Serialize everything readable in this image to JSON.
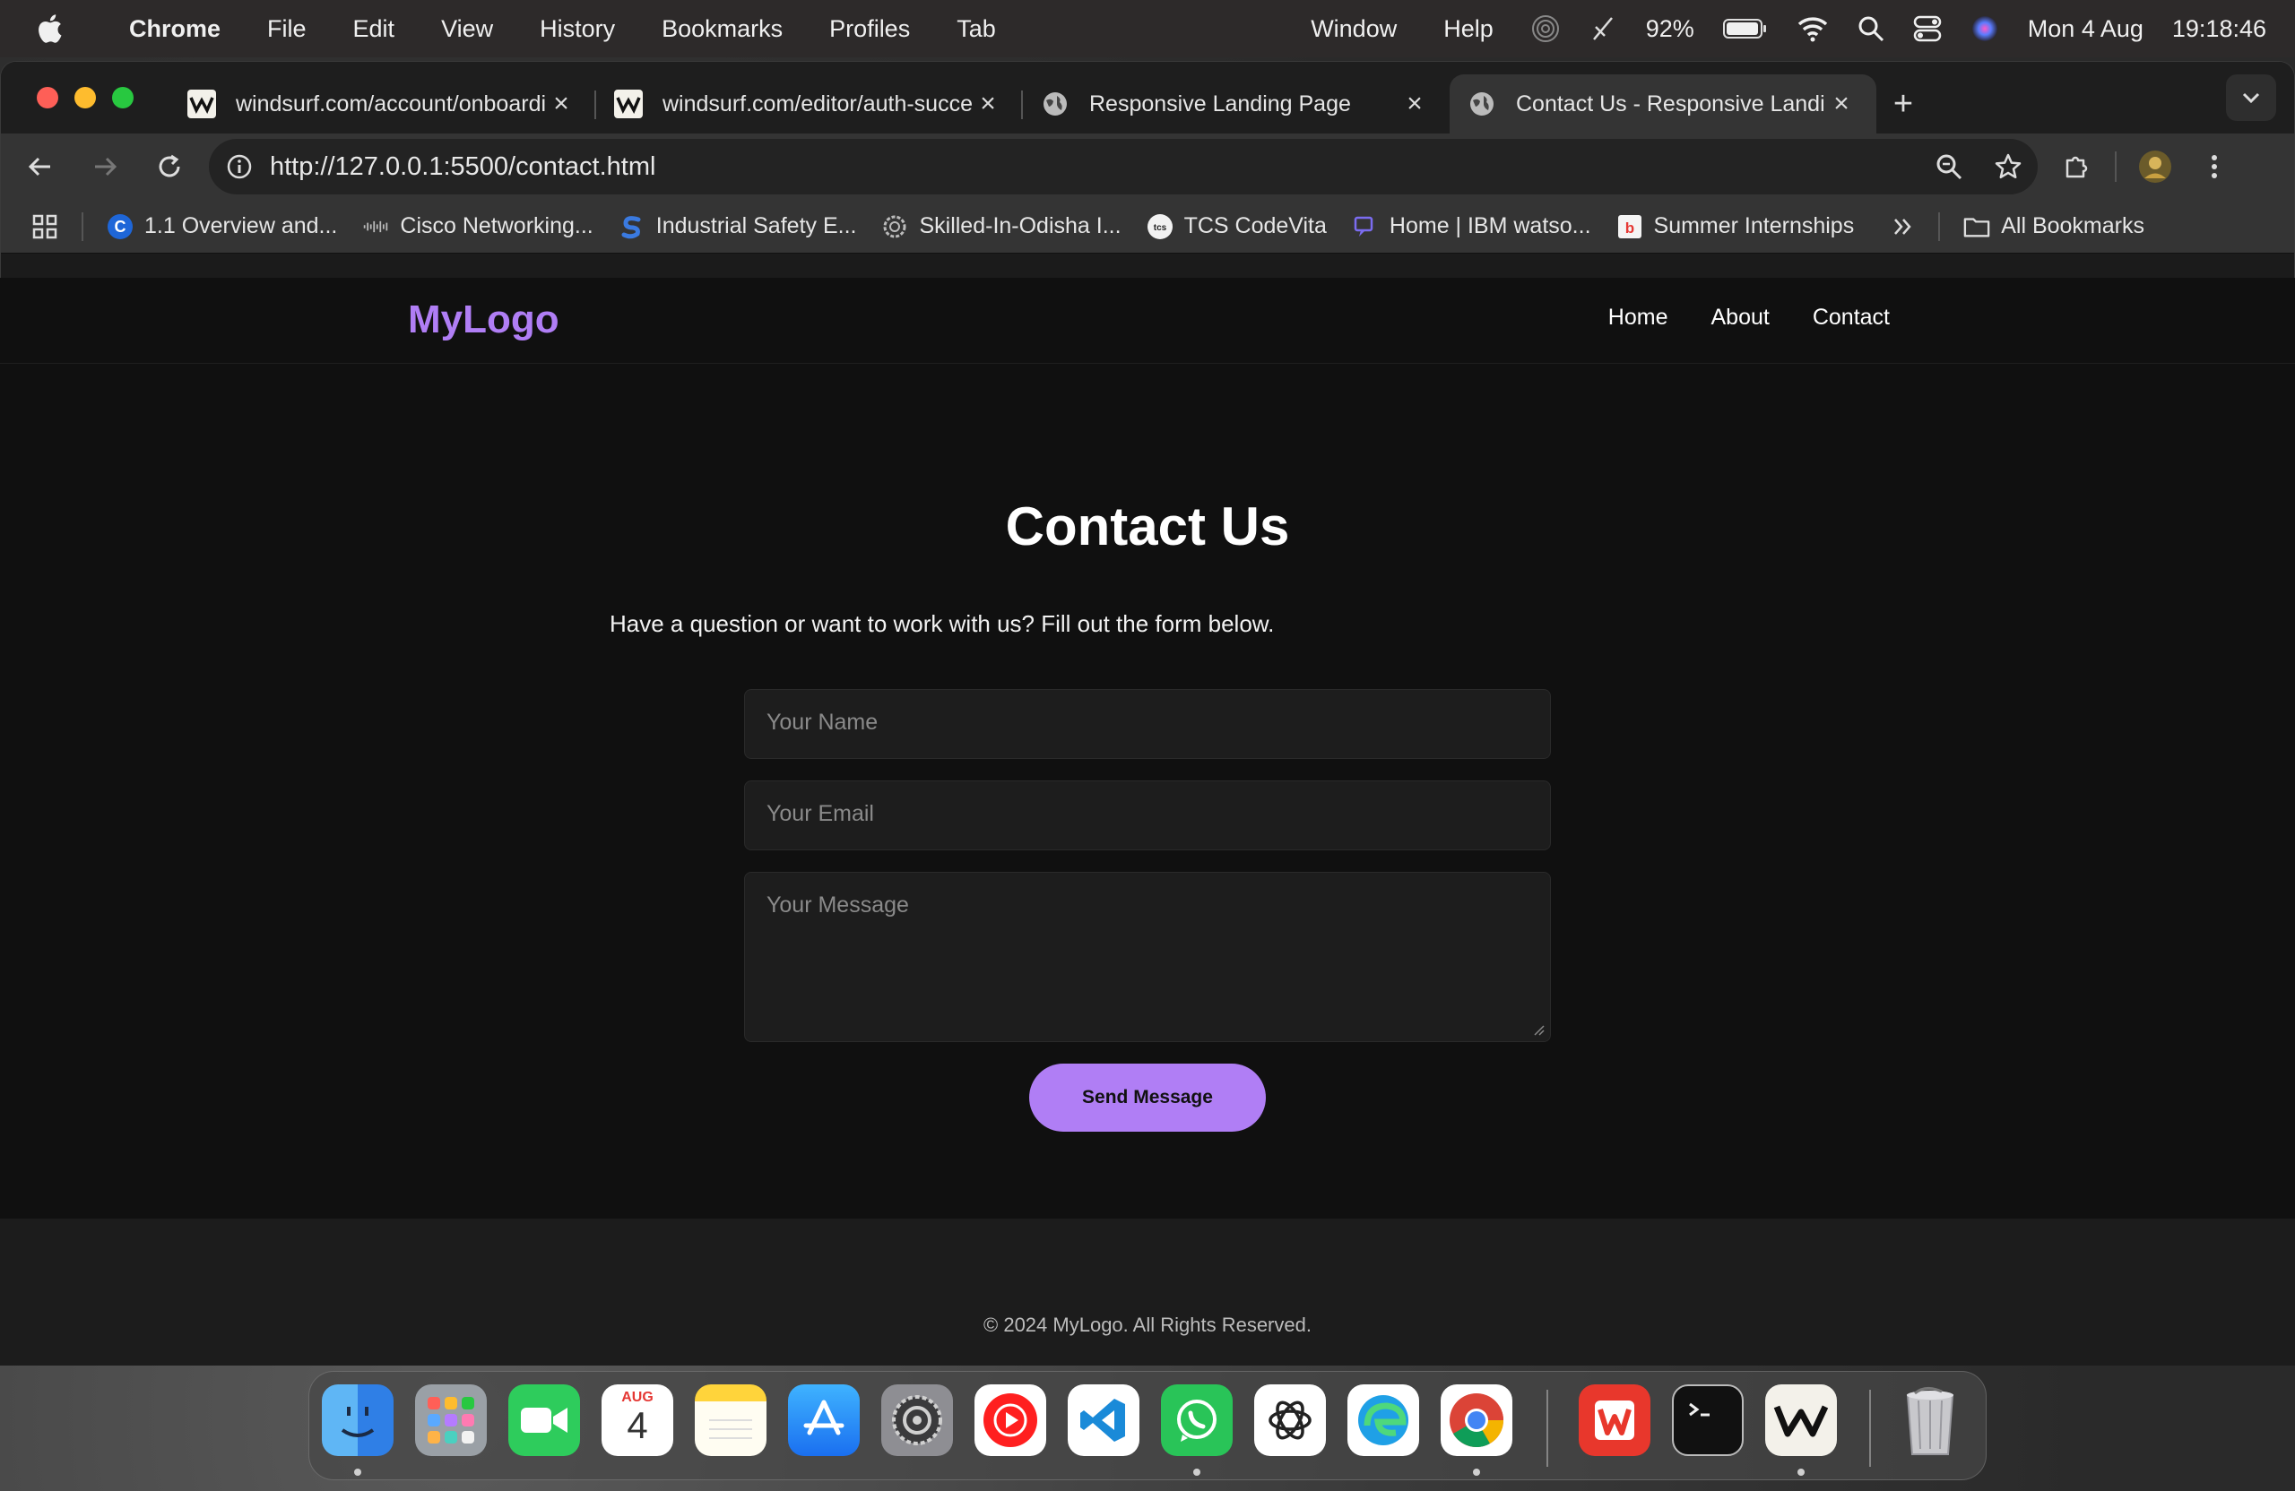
{
  "menubar": {
    "app": "Chrome",
    "menus": [
      "File",
      "Edit",
      "View",
      "History",
      "Bookmarks",
      "Profiles",
      "Tab"
    ],
    "right_menus": [
      "Window",
      "Help"
    ],
    "battery": "92%",
    "date": "Mon 4 Aug",
    "time": "19:18:46"
  },
  "tabs": [
    {
      "title": "windsurf.com/account/onboarding",
      "favicon": "windsurf-icon"
    },
    {
      "title": "windsurf.com/editor/auth-success",
      "favicon": "windsurf-icon"
    },
    {
      "title": "Responsive Landing Page",
      "favicon": "globe-icon"
    },
    {
      "title": "Contact Us - Responsive Landing Page",
      "favicon": "globe-icon",
      "active": true
    }
  ],
  "address_bar": {
    "url": "http://127.0.0.1:5500/contact.html"
  },
  "bookmarks": [
    {
      "label": "1.1 Overview and...",
      "icon": "coursera-icon"
    },
    {
      "label": "Cisco Networking...",
      "icon": "cisco-icon"
    },
    {
      "label": "Industrial Safety E...",
      "icon": "s-logo-icon"
    },
    {
      "label": "Skilled-In-Odisha I...",
      "icon": "gear-logo-icon"
    },
    {
      "label": "TCS CodeVita",
      "icon": "tcs-icon"
    },
    {
      "label": "Home | IBM watso...",
      "icon": "ibm-icon"
    },
    {
      "label": "Summer Internships",
      "icon": "internshala-icon"
    }
  ],
  "bookmarks_all": "All Bookmarks",
  "site": {
    "logo": "MyLogo",
    "nav": [
      "Home",
      "About",
      "Contact"
    ],
    "title": "Contact Us",
    "intro": "Have a question or want to work with us? Fill out the form below.",
    "form": {
      "name_placeholder": "Your Name",
      "email_placeholder": "Your Email",
      "message_placeholder": "Your Message",
      "submit": "Send Message"
    },
    "footer": "© 2024 MyLogo. All Rights Reserved."
  },
  "dock": {
    "apps": [
      "Finder",
      "Launchpad",
      "FaceTime",
      "Calendar",
      "Notes",
      "App Store",
      "System Settings",
      "YouTube Music",
      "Visual Studio Code",
      "WhatsApp",
      "ChatGPT",
      "Microsoft Edge",
      "Google Chrome",
      "WPS Office",
      "Terminal",
      "Windsurf",
      "Trash"
    ],
    "calendar_month": "AUG",
    "calendar_day": "4"
  },
  "colors": {
    "accent": "#b07ef5",
    "page_bg": "#101010",
    "field_bg": "#1d1d1d"
  }
}
